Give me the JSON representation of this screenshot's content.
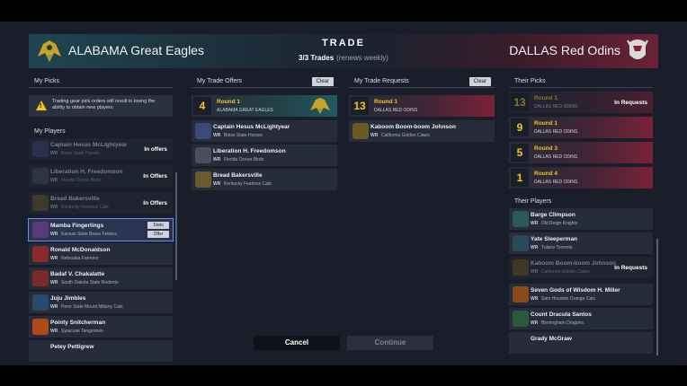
{
  "header": {
    "left_team": "ALABAMA Great Eagles",
    "right_team": "DALLAS Red Odins",
    "title": "TRADE",
    "trades_count": "3/3 Trades",
    "trades_note": "(renews weekly)"
  },
  "left_panel": {
    "my_picks_title": "My Picks",
    "warning": "Trading gear pick orders will result in losing the ability to obtain new players",
    "my_players_title": "My Players",
    "players": [
      {
        "name": "Captain Hesus McLightyear",
        "pos": "WR",
        "school": "Boise State Horses",
        "status": "In offers"
      },
      {
        "name": "Liberation H. Freedomson",
        "pos": "WR",
        "school": "Florida Ocean Birds",
        "status": "In Offers"
      },
      {
        "name": "Bread Bakersville",
        "pos": "WR",
        "school": "Kentucky Fearless Cats",
        "status": "In Offers"
      },
      {
        "name": "Mamba Fingerlings",
        "pos": "WR",
        "school": "Kansas State Brave Felines",
        "status": ""
      },
      {
        "name": "Ronald McDonaldson",
        "pos": "WR",
        "school": "Nebraska Farmers",
        "status": ""
      },
      {
        "name": "Badaf V. Chakalatte",
        "pos": "WR",
        "school": "South Dakota State Rodents",
        "status": ""
      },
      {
        "name": "Juju Jimbles",
        "pos": "WR",
        "school": "Penn State Mount Nittany Cats",
        "status": ""
      },
      {
        "name": "Pointy Snitcherman",
        "pos": "WR",
        "school": "Syracuse Tangerines",
        "status": ""
      },
      {
        "name": "Petey Pettigrew",
        "pos": "WR",
        "school": "",
        "status": ""
      }
    ],
    "stats_label": "Stats",
    "offer_label": "Offer"
  },
  "offers_panel": {
    "title": "My Trade Offers",
    "clear_label": "Clear",
    "pick": {
      "number": "4",
      "round": "Round 1",
      "team": "ALABAMA GREAT EAGLES"
    },
    "players": [
      {
        "name": "Captain Hesus McLightyear",
        "pos": "WR",
        "school": "Boise State Horses"
      },
      {
        "name": "Liberation H. Freedomson",
        "pos": "WR",
        "school": "Florida Ocean Birds"
      },
      {
        "name": "Bread Bakersville",
        "pos": "WR",
        "school": "Kentucky Fearless Cats"
      }
    ]
  },
  "requests_panel": {
    "title": "My Trade Requests",
    "clear_label": "Clear",
    "pick": {
      "number": "13",
      "round": "Round 1",
      "team": "DALLAS RED ODINS"
    },
    "players": [
      {
        "name": "Kaboom Boom-boom Johnson",
        "pos": "WR",
        "school": "California Golden Claws"
      }
    ]
  },
  "right_panel": {
    "their_picks_title": "Their Picks",
    "picks": [
      {
        "number": "13",
        "round": "Round 1",
        "team": "DALLAS RED ODINS",
        "status": "In Requests"
      },
      {
        "number": "9",
        "round": "Round 1",
        "team": "DALLAS RED ODINS",
        "status": ""
      },
      {
        "number": "5",
        "round": "Round 3",
        "team": "DALLAS RED ODINS",
        "status": ""
      },
      {
        "number": "1",
        "round": "Round 4",
        "team": "DALLAS RED ODINS",
        "status": ""
      }
    ],
    "their_players_title": "Their Players",
    "players": [
      {
        "name": "Barge Climpson",
        "pos": "WR",
        "school": "Old Reign Knights",
        "status": ""
      },
      {
        "name": "Yate Sleeperman",
        "pos": "WR",
        "school": "Tulane Torrents",
        "status": ""
      },
      {
        "name": "Kaboom Boom-boom Johnson",
        "pos": "WR",
        "school": "California Golden Claws",
        "status": "In Requests"
      },
      {
        "name": "Seven Gods of Wisdom H. Miller",
        "pos": "WR",
        "school": "Sam Houston Orange Cats",
        "status": ""
      },
      {
        "name": "Count Dracula Santos",
        "pos": "WR",
        "school": "Birmingham Dragons",
        "status": ""
      },
      {
        "name": "Grady McGraw",
        "pos": "WR",
        "school": "",
        "status": ""
      }
    ]
  },
  "buttons": {
    "cancel": "Cancel",
    "continue": "Continue"
  },
  "colors": {
    "accent_gold": "#f5c518",
    "selected_outline": "#6a8cff",
    "odins_red": "#7a2238",
    "eagles_teal": "#1f5a60"
  }
}
